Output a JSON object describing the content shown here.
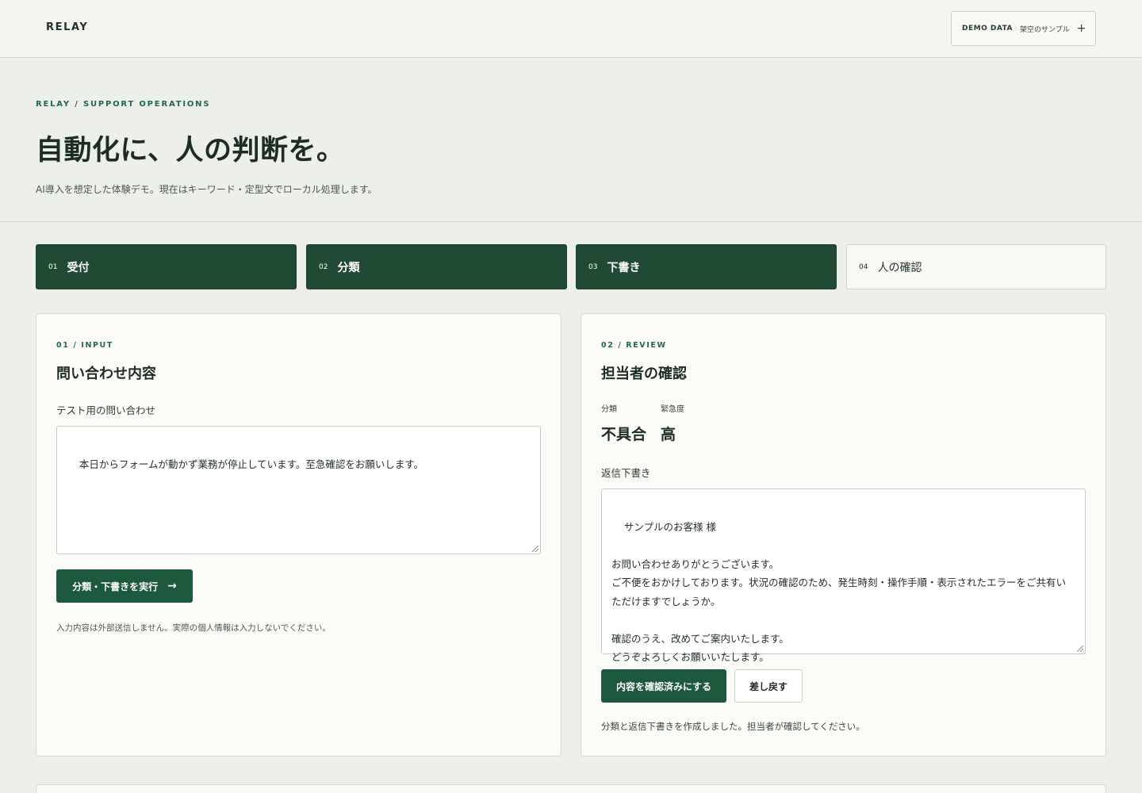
{
  "header": {
    "brand": "RELAY",
    "demo_label": "DEMO DATA",
    "demo_sub": "架空のサンプル",
    "demo_plus": "+"
  },
  "hero": {
    "eyebrow": "RELAY / SUPPORT OPERATIONS",
    "title": "自動化に、人の判断を。",
    "subtitle": "AI導入を想定した体験デモ。現在はキーワード・定型文でローカル処理します。"
  },
  "steps": [
    {
      "num": "01",
      "label": "受付",
      "state": "done"
    },
    {
      "num": "02",
      "label": "分類",
      "state": "done"
    },
    {
      "num": "03",
      "label": "下書き",
      "state": "done"
    },
    {
      "num": "04",
      "label": "人の確認",
      "state": "current"
    }
  ],
  "input_card": {
    "eyebrow": "01 / INPUT",
    "title": "問い合わせ内容",
    "field_label": "テスト用の問い合わせ",
    "textarea_value": "本日からフォームが動かず業務が停止しています。至急確認をお願いします。",
    "run_button": "分類・下書きを実行",
    "note": "入力内容は外部送信しません。実際の個人情報は入力しないでください。"
  },
  "review_card": {
    "eyebrow": "02 / REVIEW",
    "title": "担当者の確認",
    "category_label": "分類",
    "category_value": "不具合",
    "urgency_label": "緊急度",
    "urgency_value": "高",
    "draft_label": "返信下書き",
    "draft_value": "サンプルのお客様 様\n\nお問い合わせありがとうございます。\nご不便をおかけしております。状況の確認のため、発生時刻・操作手順・表示されたエラーをご共有いただけますでしょうか。\n\n確認のうえ、改めてご案内いたします。\nどうぞよろしくお願いいたします。",
    "confirm_button": "内容を確認済みにする",
    "return_button": "差し戻す",
    "status": "分類と返信下書きを作成しました。担当者が確認してください。"
  },
  "colors": {
    "accent": "#1d5a3d",
    "step_done": "#214a35",
    "background": "#edefe9"
  }
}
